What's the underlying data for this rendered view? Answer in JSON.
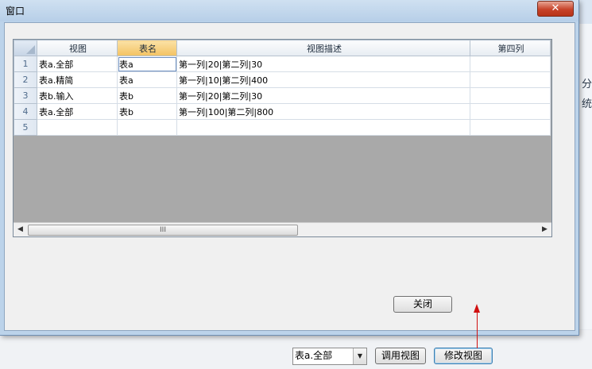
{
  "background": {
    "side_text_1": "分",
    "side_text_2": "统"
  },
  "dialog": {
    "title": "窗口",
    "close_glyph": "✕",
    "grid": {
      "columns": [
        "视图",
        "表名",
        "视图描述",
        "第四列"
      ],
      "rows": [
        {
          "num": "1",
          "view": "表a.全部",
          "table": "表a",
          "desc": "第一列|20|第二列|30",
          "col4": ""
        },
        {
          "num": "2",
          "view": "表a.精简",
          "table": "表a",
          "desc": "第一列|10|第二列|400",
          "col4": ""
        },
        {
          "num": "3",
          "view": "表b.输入",
          "table": "表b",
          "desc": "第一列|20|第二列|30",
          "col4": ""
        },
        {
          "num": "4",
          "view": "表a.全部",
          "table": "表b",
          "desc": "第一列|100|第二列|800",
          "col4": ""
        },
        {
          "num": "5",
          "view": "",
          "table": "",
          "desc": "",
          "col4": ""
        }
      ],
      "scroll_left": "◀",
      "scroll_right": "▶",
      "scroll_grip": "III"
    },
    "close_button": "关闭"
  },
  "toolbar": {
    "view_select": "表a.全部",
    "select_arrow": "▼",
    "call_view_button": "调用视图",
    "edit_view_button": "修改视图"
  },
  "colors": {
    "selected_header": "#f3c263",
    "annotation": "#d01010"
  }
}
